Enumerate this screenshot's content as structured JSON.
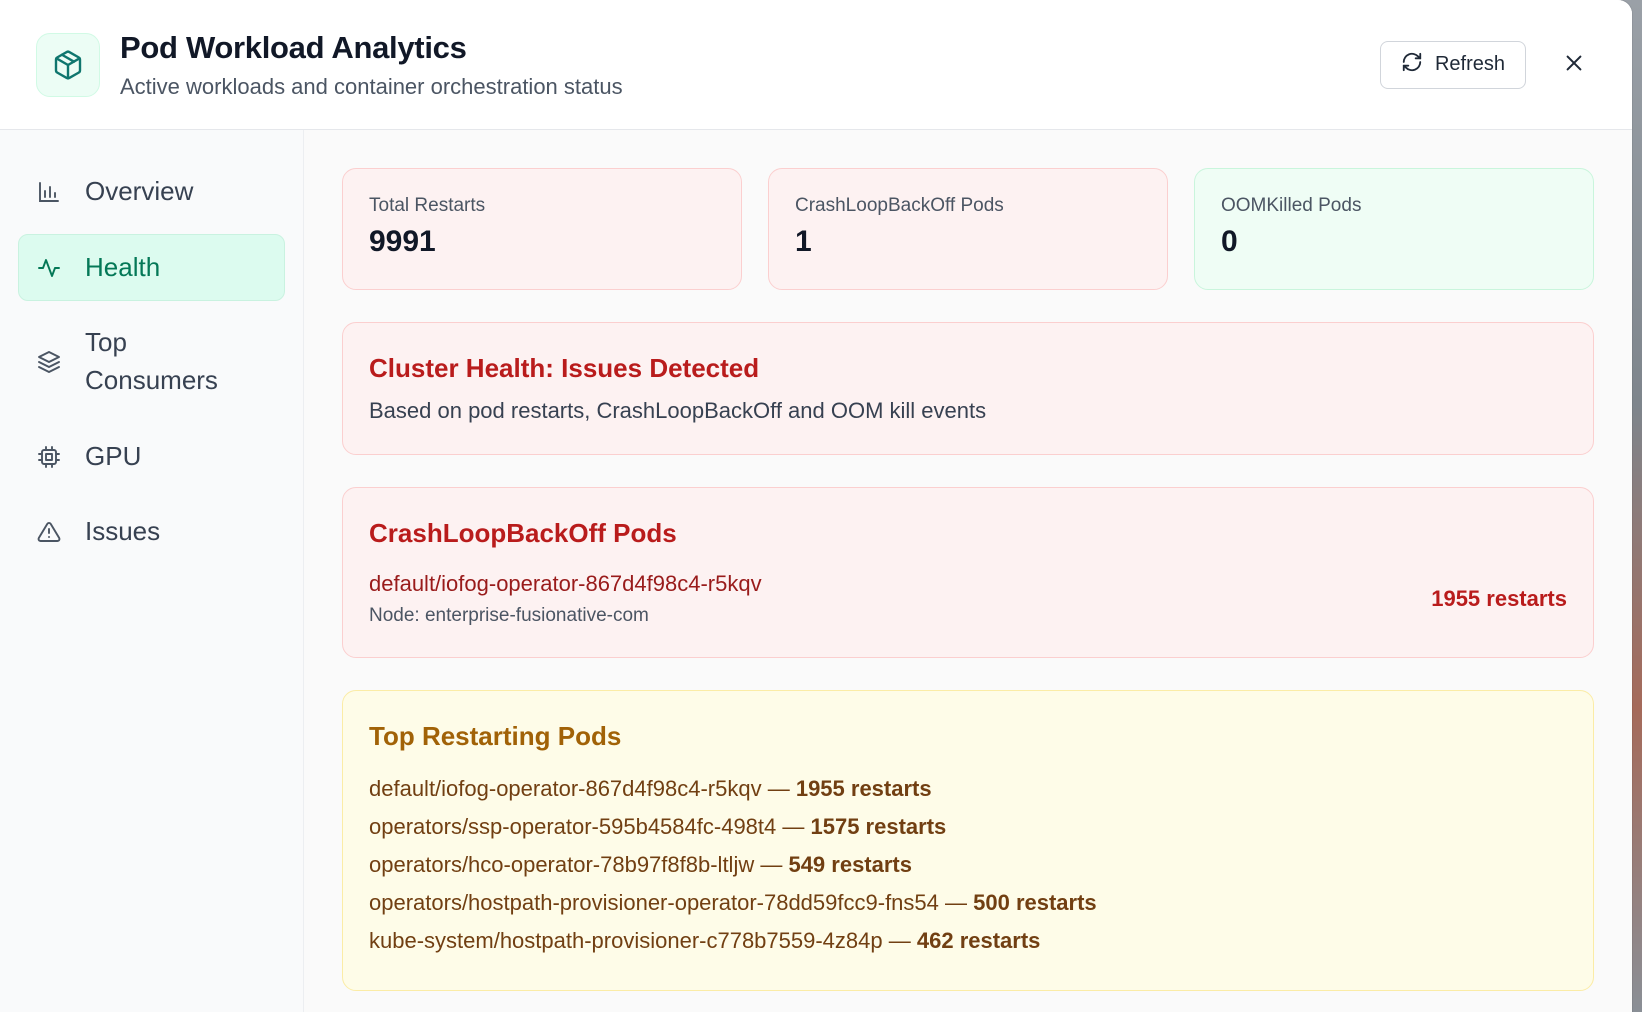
{
  "header": {
    "icon": "cube-icon",
    "title": "Pod Workload Analytics",
    "subtitle": "Active workloads and container orchestration status",
    "refresh_label": "Refresh",
    "refresh_icon": "refresh-icon",
    "close_icon": "close-icon"
  },
  "sidebar": {
    "items": [
      {
        "label": "Overview",
        "icon": "bar-chart-icon",
        "active": false
      },
      {
        "label": "Health",
        "icon": "activity-icon",
        "active": true
      },
      {
        "label": "Top Consumers",
        "icon": "layers-icon",
        "active": false
      },
      {
        "label": "GPU",
        "icon": "chip-icon",
        "active": false
      },
      {
        "label": "Issues",
        "icon": "warning-icon",
        "active": false
      }
    ]
  },
  "stats": [
    {
      "label": "Total Restarts",
      "value": "9991"
    },
    {
      "label": "CrashLoopBackOff Pods",
      "value": "1"
    },
    {
      "label": "OOMKilled Pods",
      "value": "0"
    }
  ],
  "health": {
    "title": "Cluster Health: Issues Detected",
    "description": "Based on pod restarts, CrashLoopBackOff and OOM kill events"
  },
  "crashloop": {
    "title": "CrashLoopBackOff Pods",
    "pods": [
      {
        "name": "default/iofog-operator-867d4f98c4-r5kqv",
        "node": "Node: enterprise-fusionative-com",
        "restarts": "1955 restarts"
      }
    ]
  },
  "top_restarting": {
    "title": "Top Restarting Pods",
    "items": [
      {
        "pod": "default/iofog-operator-867d4f98c4-r5kqv",
        "separator": " — ",
        "restarts": "1955 restarts"
      },
      {
        "pod": "operators/ssp-operator-595b4584fc-498t4",
        "separator": " — ",
        "restarts": "1575 restarts"
      },
      {
        "pod": "operators/hco-operator-78b97f8f8b-ltljw",
        "separator": " — ",
        "restarts": "549 restarts"
      },
      {
        "pod": "operators/hostpath-provisioner-operator-78dd59fcc9-fns54",
        "separator": " — ",
        "restarts": "500 restarts"
      },
      {
        "pod": "kube-system/hostpath-provisioner-c778b7559-4z84p",
        "separator": " — ",
        "restarts": "462 restarts"
      }
    ]
  },
  "colors": {
    "accent": "#047857",
    "danger": "#b91c1c",
    "warning": "#a16207"
  }
}
